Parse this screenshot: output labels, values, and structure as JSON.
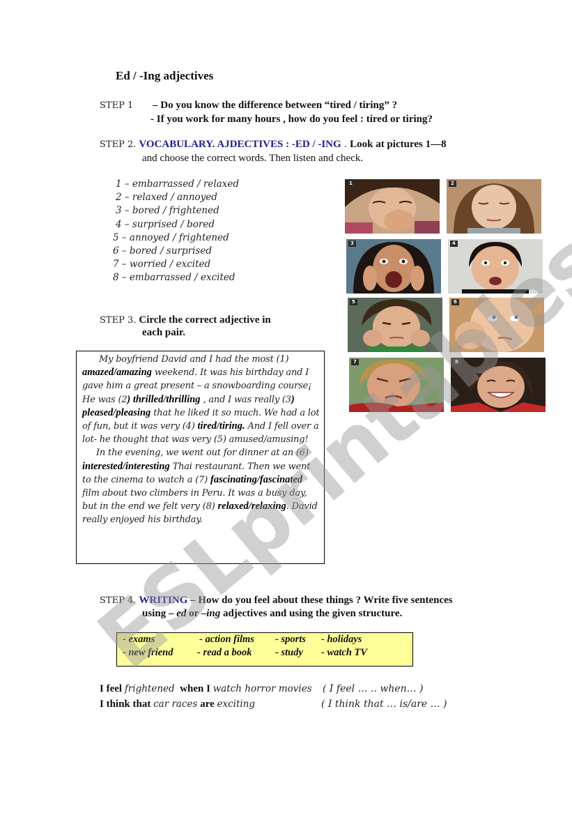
{
  "title": "Ed / -Ing  adjectives",
  "step1": {
    "label": "STEP 1",
    "question1": "– Do you know the difference between  “tired / tiring” ?",
    "question2": "- If you work for many hours , how do you feel : tired or tiring?"
  },
  "step2": {
    "label": "STEP 2.",
    "heading": "VOCABULARY. AJDECTIVES : -ED / -ING",
    "sep": " . ",
    "instruction_line1": "Look at pictures 1—8",
    "instruction_line2": "and choose the correct words. Then listen and check.",
    "items": [
      "1 – embarrassed / relaxed",
      "2 – relaxed / annoyed",
      "3 – bored / frightened",
      "4 – surprised / bored",
      "5 – annoyed / frightened",
      "6 – bored / surprised",
      "7 – worried / excited",
      "8 – embarrassed / excited"
    ],
    "photos": [
      {
        "number": "1",
        "description": "woman covering her mouth, laughing"
      },
      {
        "number": "2",
        "description": "woman with eyes closed"
      },
      {
        "number": "3",
        "description": "woman screaming with hands on face"
      },
      {
        "number": "4",
        "description": "man with wide eyes and open mouth"
      },
      {
        "number": "5",
        "description": "boy resting chin on hands, frowning"
      },
      {
        "number": "6",
        "description": "girl resting face on hand, rolling eyes"
      },
      {
        "number": "7",
        "description": "man grimacing"
      },
      {
        "number": "8",
        "description": "woman smiling broadly"
      }
    ]
  },
  "step3": {
    "label": "STEP 3.",
    "instruction_line1": "Circle the correct adjective in",
    "instruction_line2": "each pair.",
    "story": {
      "p1_a": "My boyfriend David and I had the most (1) ",
      "p1_b1": "amazed/amazing",
      "p1_c": " weekend. It was his birthday and I gave him a great present – a snowboarding course¡ He was (2",
      "p1_b2": ") thrilled/thrilling",
      "p1_d": " , and I was really (3",
      "p1_b3": ") pleased/pleasing",
      "p1_e": " that he liked it so much. We had a lot of fun, but it was very (4) ",
      "p1_b4": "tired/tiring.",
      "p1_f": " And I fell over a lot- he thought that was very (5) amused/amusing!",
      "p2_a": "In the evening, we went out for dinner at an (6) ",
      "p2_b6": "interested/interesting",
      "p2_c": " Thai restaurant. Then we went to the cinema to watch a (7) ",
      "p2_b7": "fascinating/fascinated",
      "p2_d": " film about two climbers in Peru. It was a busy day, but in the end we felt very (8) ",
      "p2_b8": "relaxed/relaxing",
      "p2_e": ". David really enjoyed his birthday."
    }
  },
  "step4": {
    "label": "STEP 4.",
    "heading": "WRITING –",
    "instruction_line1": " How do you feel about these things ? Write five sentences",
    "instruction_line2_a": "using – ",
    "instruction_line2_ed": "ed",
    "instruction_line2_b": " or –",
    "instruction_line2_ing": "ing",
    "instruction_line2_c": " adjectives and using the given structure.",
    "topics": [
      "- exams",
      "- action films",
      "- sports",
      "- holidays",
      "- new friend",
      "- read a book",
      "- study",
      "- watch TV"
    ],
    "examples": [
      {
        "parts": [
          "I feel ",
          "frightened",
          "  when I ",
          "watch horror movies"
        ],
        "hint": "( I feel … .. when…  )"
      },
      {
        "parts": [
          "I think that ",
          "car races",
          " are ",
          "exciting"
        ],
        "hint": "( I think that … is/are … )"
      }
    ]
  },
  "watermark": "ESLprintables.com",
  "colors": {
    "heading_blue": "#1f1f8f",
    "topics_background": "#ffff99",
    "watermark_gray": "#969696"
  }
}
